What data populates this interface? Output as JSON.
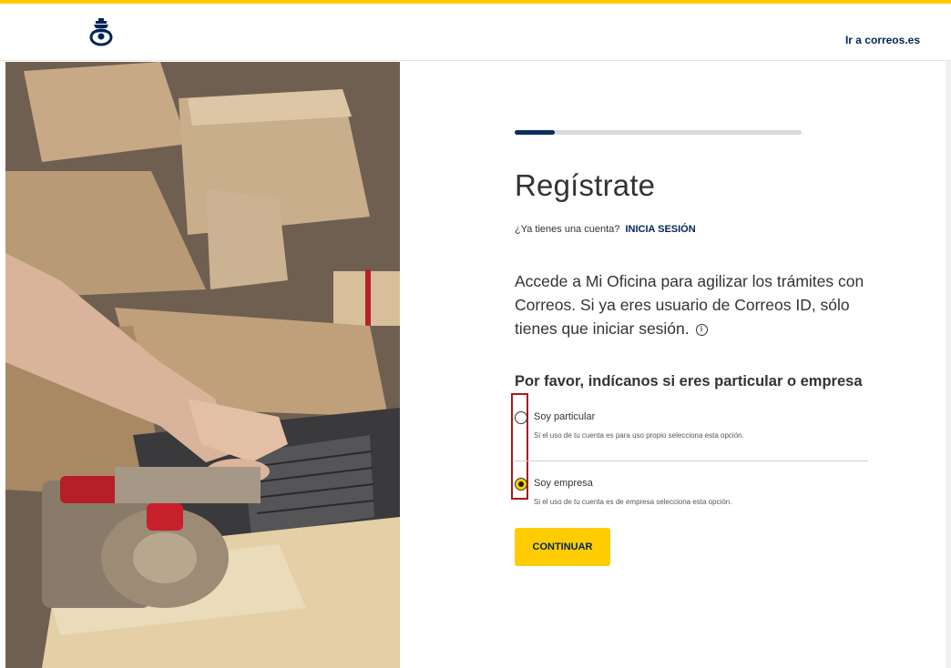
{
  "header": {
    "logo_icon": "correos-horn-crown-logo",
    "link_label": "Ir a correos.es"
  },
  "hero": {
    "icon": "parcels-laptop-photo"
  },
  "progress": {
    "value_fraction": 0.14
  },
  "form": {
    "title": "Regístrate",
    "login_prompt": "¿Ya tienes una cuenta?",
    "login_link": "INICIA SESIÓN",
    "intro": "Accede a Mi Oficina para agilizar los trámites con Correos. Si ya eres usuario de Correos ID, sólo tienes que iniciar sesión.",
    "info_icon": "i",
    "question": "Por favor, indícanos si eres particular o empresa",
    "options": [
      {
        "label": "Soy particular",
        "description": "Si el uso de tu cuenta es para uso propio selecciona esta opción.",
        "selected": false
      },
      {
        "label": "Soy empresa",
        "description": "Si el uso de tu cuenta es de empresa selecciona esta opción.",
        "selected": true
      }
    ],
    "continue_label": "CONTINUAR"
  },
  "colors": {
    "accent_yellow": "#fecc00",
    "brand_navy": "#002453",
    "highlight_red": "#a6191e"
  }
}
